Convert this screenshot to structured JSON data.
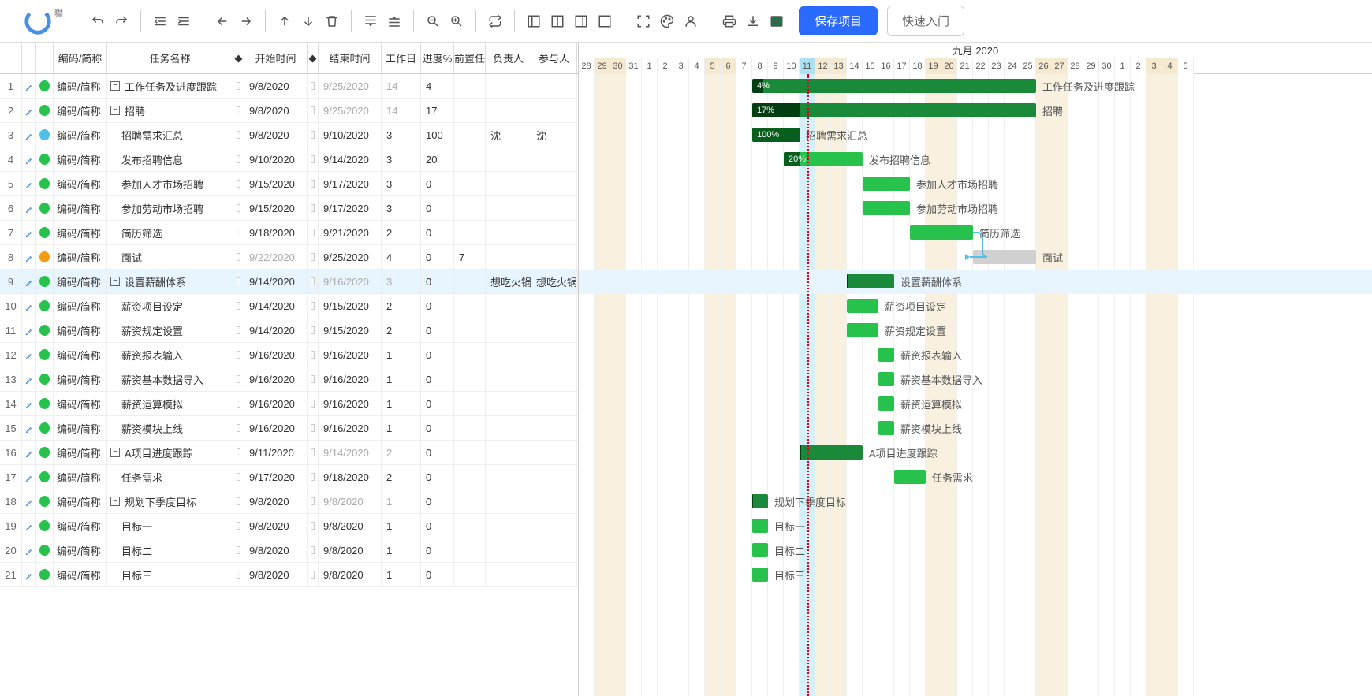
{
  "toolbar": {
    "save_label": "保存项目",
    "quickstart_label": "快速入门",
    "logo_badge": "猫"
  },
  "columns": {
    "code": "编码/简称",
    "name": "任务名称",
    "start": "开始时间",
    "end": "结束时间",
    "dur": "工作日",
    "prog": "进度%",
    "pred": "前置任",
    "own": "负责人",
    "part": "参与人"
  },
  "gantt_header": "九月 2020",
  "code_cell": "编码/简称",
  "day_start": 28,
  "days": [
    {
      "n": 28,
      "we": false
    },
    {
      "n": 29,
      "we": true
    },
    {
      "n": 30,
      "we": true
    },
    {
      "n": 31,
      "we": false
    },
    {
      "n": 1,
      "we": false
    },
    {
      "n": 2,
      "we": false
    },
    {
      "n": 3,
      "we": false
    },
    {
      "n": 4,
      "we": false
    },
    {
      "n": 5,
      "we": true
    },
    {
      "n": 6,
      "we": true
    },
    {
      "n": 7,
      "we": false
    },
    {
      "n": 8,
      "we": false
    },
    {
      "n": 9,
      "we": false
    },
    {
      "n": 10,
      "we": false
    },
    {
      "n": 11,
      "we": false,
      "today": true
    },
    {
      "n": 12,
      "we": true
    },
    {
      "n": 13,
      "we": true
    },
    {
      "n": 14,
      "we": false
    },
    {
      "n": 15,
      "we": false
    },
    {
      "n": 16,
      "we": false
    },
    {
      "n": 17,
      "we": false
    },
    {
      "n": 18,
      "we": false
    },
    {
      "n": 19,
      "we": true
    },
    {
      "n": 20,
      "we": true
    },
    {
      "n": 21,
      "we": false
    },
    {
      "n": 22,
      "we": false
    },
    {
      "n": 23,
      "we": false
    },
    {
      "n": 24,
      "we": false
    },
    {
      "n": 25,
      "we": false
    },
    {
      "n": 26,
      "we": true
    },
    {
      "n": 27,
      "we": true
    },
    {
      "n": 28,
      "we": false
    },
    {
      "n": 29,
      "we": false
    },
    {
      "n": 30,
      "we": false
    },
    {
      "n": 1,
      "we": false
    },
    {
      "n": 2,
      "we": false
    },
    {
      "n": 3,
      "we": true
    },
    {
      "n": 4,
      "we": true
    },
    {
      "n": 5,
      "we": false
    }
  ],
  "rows": [
    {
      "id": 1,
      "dot": "green",
      "indent": 0,
      "toggle": "-",
      "name": "工作任务及进度跟踪",
      "start": "9/8/2020",
      "end": "9/25/2020",
      "end_muted": true,
      "dur": "14",
      "dur_muted": true,
      "prog": "4",
      "pred": "",
      "own": "",
      "part": "",
      "bar": {
        "startDay": 11,
        "span": 18,
        "prog": 4,
        "progLbl": "4%",
        "dark": true
      }
    },
    {
      "id": 2,
      "dot": "green",
      "indent": 0,
      "toggle": "-",
      "name": "招聘",
      "start": "9/8/2020",
      "end": "9/25/2020",
      "end_muted": true,
      "dur": "14",
      "dur_muted": true,
      "prog": "17",
      "pred": "",
      "own": "",
      "part": "",
      "bar": {
        "startDay": 11,
        "span": 18,
        "prog": 17,
        "progLbl": "17%",
        "dark": true
      }
    },
    {
      "id": 3,
      "dot": "blue",
      "indent": 1,
      "name": "招聘需求汇总",
      "start": "9/8/2020",
      "end": "9/10/2020",
      "dur": "3",
      "prog": "100",
      "pred": "",
      "own": "沈",
      "part": "沈",
      "bar": {
        "startDay": 11,
        "span": 3,
        "prog": 100,
        "progLbl": "100%",
        "blue": true
      }
    },
    {
      "id": 4,
      "dot": "green",
      "indent": 1,
      "name": "发布招聘信息",
      "start": "9/10/2020",
      "end": "9/14/2020",
      "dur": "3",
      "prog": "20",
      "pred": "",
      "own": "",
      "part": "",
      "bar": {
        "startDay": 13,
        "span": 5,
        "prog": 20,
        "progLbl": "20%"
      }
    },
    {
      "id": 5,
      "dot": "green",
      "indent": 1,
      "name": "参加人才市场招聘",
      "start": "9/15/2020",
      "end": "9/17/2020",
      "dur": "3",
      "prog": "0",
      "pred": "",
      "own": "",
      "part": "",
      "bar": {
        "startDay": 18,
        "span": 3
      }
    },
    {
      "id": 6,
      "dot": "green",
      "indent": 1,
      "name": "参加劳动市场招聘",
      "start": "9/15/2020",
      "end": "9/17/2020",
      "dur": "3",
      "prog": "0",
      "pred": "",
      "own": "",
      "part": "",
      "bar": {
        "startDay": 18,
        "span": 3
      }
    },
    {
      "id": 7,
      "dot": "green",
      "indent": 1,
      "name": "简历筛选",
      "start": "9/18/2020",
      "end": "9/21/2020",
      "dur": "2",
      "prog": "0",
      "pred": "",
      "own": "",
      "part": "",
      "bar": {
        "startDay": 21,
        "span": 4
      }
    },
    {
      "id": 8,
      "dot": "orange",
      "indent": 1,
      "name": "面试",
      "start": "9/22/2020",
      "start_muted": true,
      "end": "9/25/2020",
      "dur": "4",
      "prog": "0",
      "pred": "7",
      "own": "",
      "part": "",
      "bar": {
        "startDay": 25,
        "span": 4,
        "grey": true
      },
      "link_from": 7
    },
    {
      "id": 9,
      "dot": "green",
      "indent": 0,
      "toggle": "-",
      "name": "设置薪酬体系",
      "start": "9/14/2020",
      "end": "9/16/2020",
      "end_muted": true,
      "dur": "3",
      "dur_muted": true,
      "prog": "0",
      "pred": "",
      "own": "想吃火锅",
      "part": "想吃火锅",
      "sel": true,
      "bar": {
        "startDay": 17,
        "span": 3,
        "dark": true,
        "prog": 0
      }
    },
    {
      "id": 10,
      "dot": "green",
      "indent": 1,
      "name": "薪资项目设定",
      "start": "9/14/2020",
      "end": "9/15/2020",
      "dur": "2",
      "prog": "0",
      "pred": "",
      "own": "",
      "part": "",
      "bar": {
        "startDay": 17,
        "span": 2
      }
    },
    {
      "id": 11,
      "dot": "green",
      "indent": 1,
      "name": "薪资规定设置",
      "start": "9/14/2020",
      "end": "9/15/2020",
      "dur": "2",
      "prog": "0",
      "pred": "",
      "own": "",
      "part": "",
      "bar": {
        "startDay": 17,
        "span": 2
      }
    },
    {
      "id": 12,
      "dot": "green",
      "indent": 1,
      "name": "薪资报表输入",
      "start": "9/16/2020",
      "end": "9/16/2020",
      "dur": "1",
      "prog": "0",
      "pred": "",
      "own": "",
      "part": "",
      "bar": {
        "startDay": 19,
        "span": 1
      }
    },
    {
      "id": 13,
      "dot": "green",
      "indent": 1,
      "name": "薪资基本数据导入",
      "start": "9/16/2020",
      "end": "9/16/2020",
      "dur": "1",
      "prog": "0",
      "pred": "",
      "own": "",
      "part": "",
      "bar": {
        "startDay": 19,
        "span": 1
      }
    },
    {
      "id": 14,
      "dot": "green",
      "indent": 1,
      "name": "薪资运算模拟",
      "start": "9/16/2020",
      "end": "9/16/2020",
      "dur": "1",
      "prog": "0",
      "pred": "",
      "own": "",
      "part": "",
      "bar": {
        "startDay": 19,
        "span": 1
      }
    },
    {
      "id": 15,
      "dot": "green",
      "indent": 1,
      "name": "薪资模块上线",
      "start": "9/16/2020",
      "end": "9/16/2020",
      "dur": "1",
      "prog": "0",
      "pred": "",
      "own": "",
      "part": "",
      "bar": {
        "startDay": 19,
        "span": 1
      }
    },
    {
      "id": 16,
      "dot": "green",
      "indent": 0,
      "toggle": "-",
      "name": "A项目进度跟踪",
      "start": "9/11/2020",
      "end": "9/14/2020",
      "end_muted": true,
      "dur": "2",
      "dur_muted": true,
      "prog": "0",
      "pred": "",
      "own": "",
      "part": "",
      "bar": {
        "startDay": 14,
        "span": 4,
        "dark": true,
        "prog": 0
      }
    },
    {
      "id": 17,
      "dot": "green",
      "indent": 1,
      "name": "任务需求",
      "start": "9/17/2020",
      "end": "9/18/2020",
      "dur": "2",
      "prog": "0",
      "pred": "",
      "own": "",
      "part": "",
      "bar": {
        "startDay": 20,
        "span": 2
      }
    },
    {
      "id": 18,
      "dot": "green",
      "indent": 0,
      "toggle": "-",
      "name": "规划下季度目标",
      "start": "9/8/2020",
      "end": "9/8/2020",
      "end_muted": true,
      "dur": "1",
      "dur_muted": true,
      "prog": "0",
      "pred": "",
      "own": "",
      "part": "",
      "bar": {
        "startDay": 11,
        "span": 1,
        "dark": true,
        "prog": 0
      }
    },
    {
      "id": 19,
      "dot": "green",
      "indent": 1,
      "name": "目标一",
      "start": "9/8/2020",
      "end": "9/8/2020",
      "dur": "1",
      "prog": "0",
      "pred": "",
      "own": "",
      "part": "",
      "bar": {
        "startDay": 11,
        "span": 1
      }
    },
    {
      "id": 20,
      "dot": "green",
      "indent": 1,
      "name": "目标二",
      "start": "9/8/2020",
      "end": "9/8/2020",
      "dur": "1",
      "prog": "0",
      "pred": "",
      "own": "",
      "part": "",
      "bar": {
        "startDay": 11,
        "span": 1
      }
    },
    {
      "id": 21,
      "dot": "green",
      "indent": 1,
      "name": "目标三",
      "start": "9/8/2020",
      "end": "9/8/2020",
      "dur": "1",
      "prog": "0",
      "pred": "",
      "own": "",
      "part": "",
      "bar": {
        "startDay": 11,
        "span": 1
      }
    }
  ]
}
